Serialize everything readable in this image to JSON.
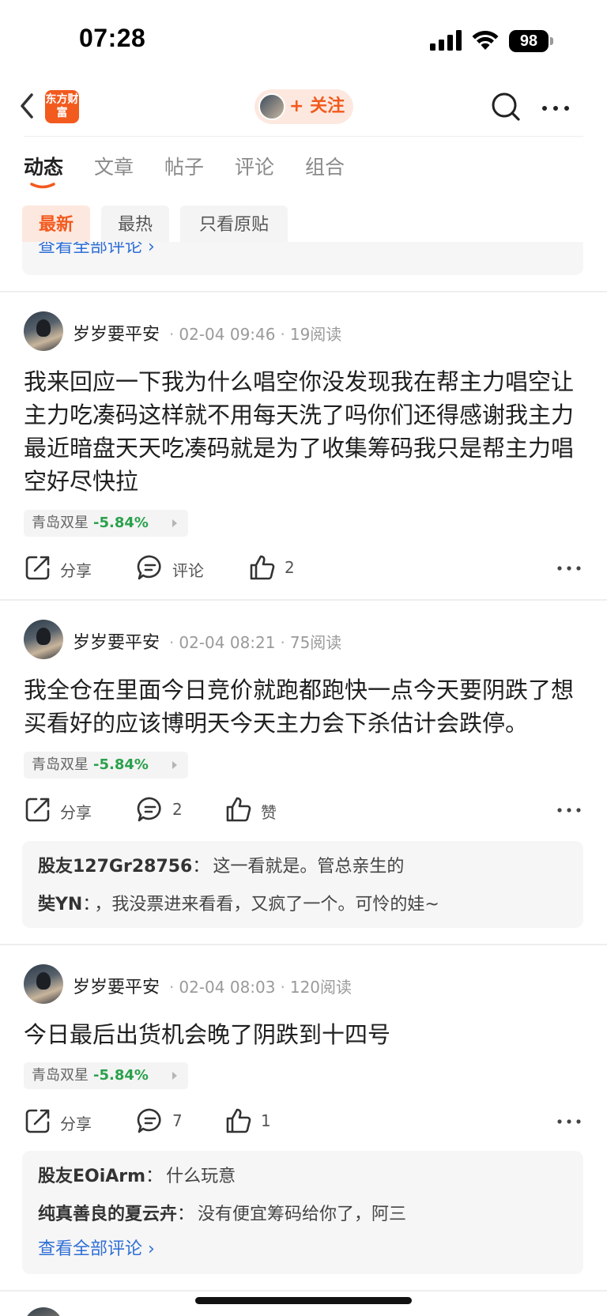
{
  "status_bar": {
    "time": "07:28",
    "battery": "98"
  },
  "nav": {
    "logo_text": "东方财富",
    "follow_label": "+ 关注"
  },
  "tabs": [
    {
      "label": "动态",
      "active": true
    },
    {
      "label": "文章"
    },
    {
      "label": "帖子"
    },
    {
      "label": "评论"
    },
    {
      "label": "组合"
    }
  ],
  "filters": [
    {
      "label": "最新",
      "active": true
    },
    {
      "label": "最热"
    },
    {
      "label": "只看原贴"
    }
  ],
  "prev_card": {
    "view_all": "查看全部评论 ›"
  },
  "colors": {
    "brand": "#f25a1e",
    "stock_down": "#2aa14c",
    "link": "#2f6fd6"
  },
  "actions": {
    "share": "分享",
    "comment": "评论",
    "like": "赞"
  },
  "posts": [
    {
      "username": "岁岁要平安",
      "time": "02-04 09:46",
      "reads": "19阅读",
      "content": "我来回应一下我为什么唱空你没发现我在帮主力唱空让主力吃凑码这样就不用每天洗了吗你们还得感谢我主力最近暗盘天天吃凑码就是为了收集筹码我只是帮主力唱空好尽快拉",
      "stock": {
        "name": "青岛双星",
        "change": "-5.84%"
      },
      "comment_label": "评论",
      "like_label": "2"
    },
    {
      "username": "岁岁要平安",
      "time": "02-04 08:21",
      "reads": "75阅读",
      "content": "我全仓在里面今日竞价就跑都跑快一点今天要阴跌了想买看好的应该博明天今天主力会下杀估计会跌停。",
      "stock": {
        "name": "青岛双星",
        "change": "-5.84%"
      },
      "comment_label": "2",
      "like_label": "赞",
      "comments": [
        {
          "user": "股友127Gr28756",
          "text": "这一看就是。管总亲生的"
        },
        {
          "user": "奘YN",
          "text": "，我没票进来看看，又疯了一个。可怜的娃~"
        }
      ]
    },
    {
      "username": "岁岁要平安",
      "time": "02-04 08:03",
      "reads": "120阅读",
      "content": "今日最后出货机会晚了阴跌到十四号",
      "stock": {
        "name": "青岛双星",
        "change": "-5.84%"
      },
      "comment_label": "7",
      "like_label": "1",
      "comments": [
        {
          "user": "股友EOiArm",
          "text": "什么玩意"
        },
        {
          "user": "纯真善良的夏云卉",
          "text": "没有便宜筹码给你了，阿三"
        }
      ],
      "view_all": "查看全部评论 ›"
    }
  ]
}
